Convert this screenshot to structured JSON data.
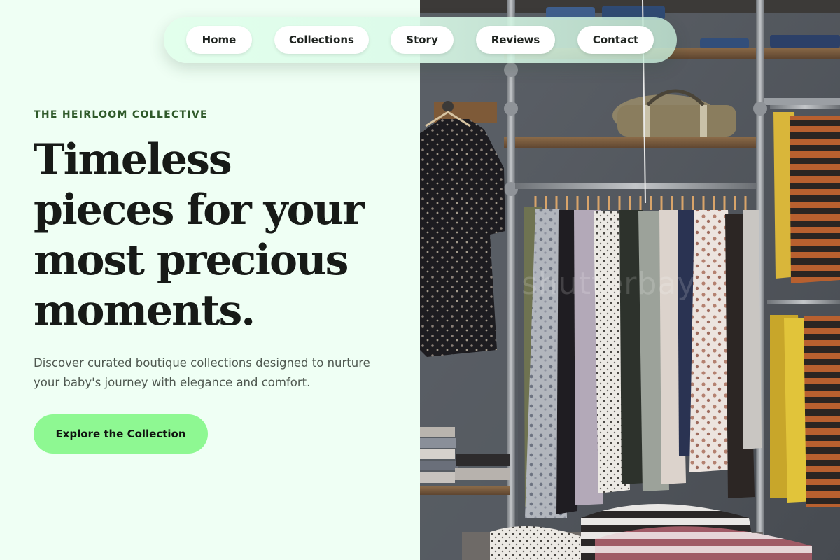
{
  "nav": {
    "items": [
      {
        "label": "Home"
      },
      {
        "label": "Collections"
      },
      {
        "label": "Story"
      },
      {
        "label": "Reviews"
      },
      {
        "label": "Contact"
      }
    ]
  },
  "hero": {
    "eyebrow": "THE HEIRLOOM COLLECTIVE",
    "headline_lines": [
      "Timeless",
      "pieces for your",
      "most precious",
      "moments."
    ],
    "subtext": "Discover curated boutique collections designed to nurture your baby's journey with elegance and comfort.",
    "cta_label": "Explore the Collection"
  },
  "photo": {
    "watermark": "shutterbay"
  },
  "colors": {
    "page_background": "#effff4",
    "accent_button": "#8ef892",
    "eyebrow": "#2f5a2a",
    "headline": "#171a17",
    "subtext": "#4f5850"
  }
}
